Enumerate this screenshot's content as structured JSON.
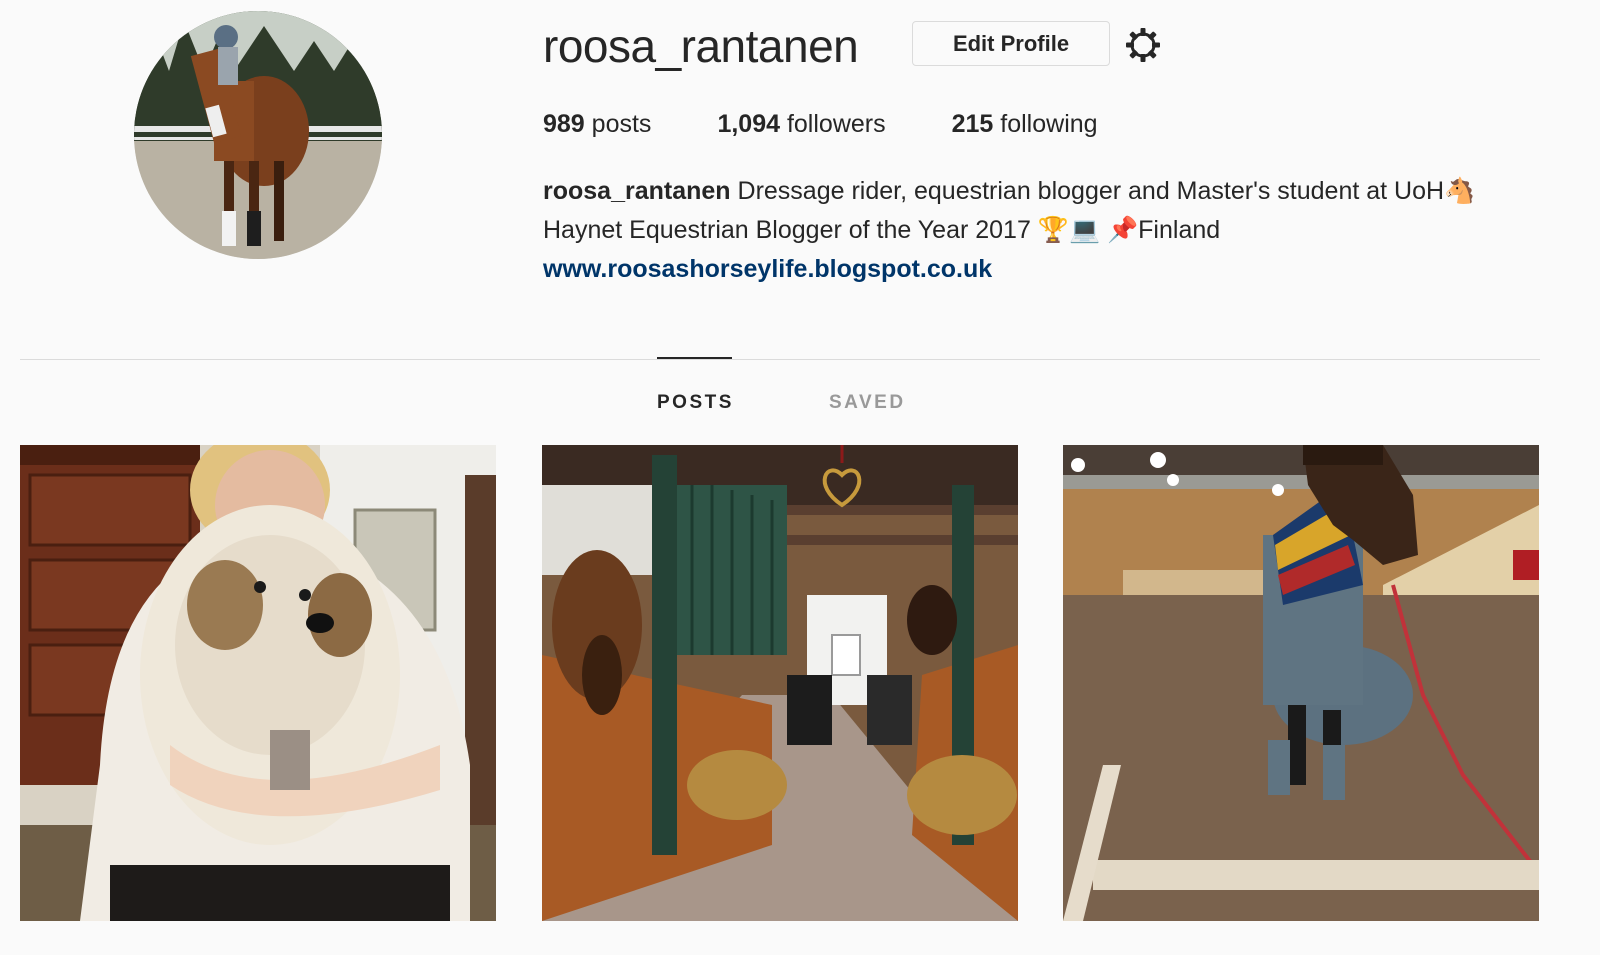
{
  "profile": {
    "username": "roosa_rantanen",
    "edit_profile_label": "Edit Profile",
    "settings_icon": "gear-icon"
  },
  "stats": {
    "posts_count": "989",
    "posts_label": "posts",
    "followers_count": "1,094",
    "followers_label": "followers",
    "following_count": "215",
    "following_label": "following"
  },
  "bio": {
    "name": "roosa_rantanen",
    "line1_text": "Dressage rider, equestrian blogger and Master's student at UoH",
    "line1_emoji": "🐴",
    "line2_text": "Haynet Equestrian Blogger of the Year 2017",
    "line2_emoji": "🏆💻 📌",
    "line2_location": "Finland",
    "link": "www.roosashorseylife.blogspot.co.uk"
  },
  "tabs": {
    "posts": "POSTS",
    "saved": "SAVED",
    "active": "posts"
  },
  "posts": [
    {
      "subject": "woman hugging fluffy dog"
    },
    {
      "subject": "stable aisle with horses"
    },
    {
      "subject": "horse in blanket in indoor arena"
    }
  ],
  "colors": {
    "background": "#fafafa",
    "text": "#262626",
    "link": "#003569",
    "muted": "#999999",
    "border": "#dbdbdb"
  }
}
